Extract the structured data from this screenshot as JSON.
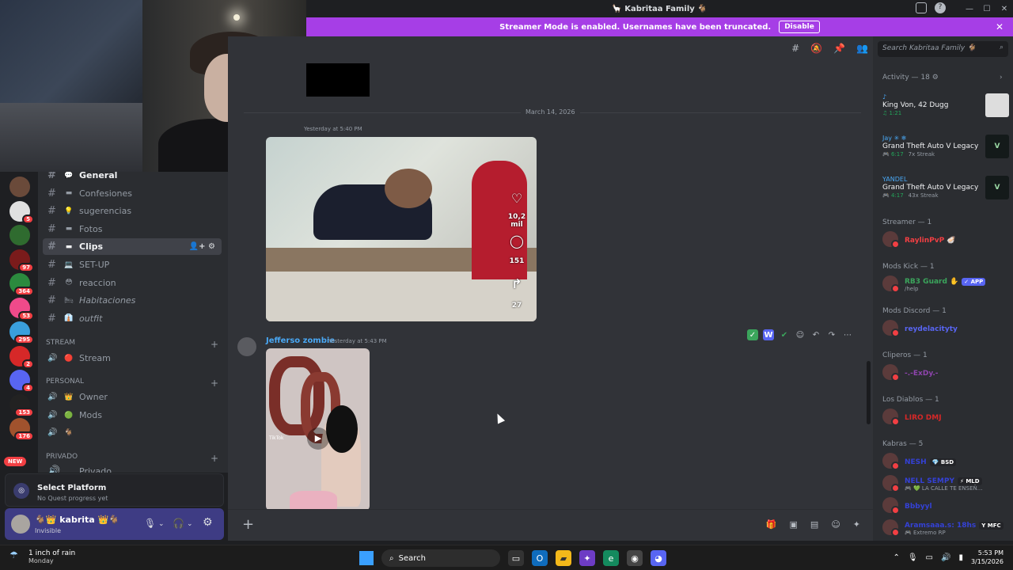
{
  "window": {
    "title": "🦙 Kabritaa Family 🐐",
    "controls": [
      "—",
      "☐",
      "✕"
    ]
  },
  "banner": {
    "text": "Streamer Mode is enabled. Usernames have been truncated.",
    "button": "Disable"
  },
  "servers": [
    {
      "badge": "",
      "color": "#6a4a3a"
    },
    {
      "badge": "5",
      "color": "#e0e0e0"
    },
    {
      "badge": "",
      "color": "#2f6b2f"
    },
    {
      "badge": "97",
      "color": "#7a1b1b"
    },
    {
      "badge": "364",
      "color": "#2b8a3e"
    },
    {
      "badge": "53",
      "color": "#f04a8a"
    },
    {
      "badge": "295",
      "color": "#3a9fdc"
    },
    {
      "badge": "2",
      "color": "#d62828"
    },
    {
      "badge": "4",
      "color": "#5865f2"
    },
    {
      "badge": "153",
      "color": "#222"
    },
    {
      "badge": "176",
      "color": "#a0522d"
    }
  ],
  "server_new_label": "NEW",
  "channels": [
    {
      "label": "General",
      "emoji": "💬",
      "style": "gen"
    },
    {
      "label": "Confesiones",
      "emoji": "▬",
      "style": ""
    },
    {
      "label": "sugerencias",
      "emoji": "💡",
      "style": ""
    },
    {
      "label": "Fotos",
      "emoji": "▬",
      "style": ""
    },
    {
      "label": "Clips",
      "emoji": "▬",
      "style": "active"
    },
    {
      "label": "SET-UP",
      "emoji": "💻",
      "style": ""
    },
    {
      "label": "reaccion",
      "emoji": "😳",
      "style": ""
    },
    {
      "label": "Habitaciones",
      "emoji": "🛏",
      "style": "italic"
    },
    {
      "label": "outfit",
      "emoji": "👔",
      "style": "italic"
    }
  ],
  "categories": {
    "stream": "STREAM",
    "personal": "PERSONAL",
    "privado": "PRIVADO"
  },
  "voice_channels": [
    {
      "label": "Stream",
      "emoji": "🔴"
    },
    {
      "label": "Owner",
      "emoji": "👑"
    },
    {
      "label": "Mods",
      "emoji": "🟢"
    },
    {
      "label": "",
      "emoji": "🐐"
    }
  ],
  "private_partial": "Privado",
  "quest": {
    "title": "Select Platform",
    "subtitle": "No Quest progress yet"
  },
  "user": {
    "name": "🐐👑 kabrita 👑🐐",
    "status": "Invisible"
  },
  "chat": {
    "date_divider": "March 14, 2026",
    "first_time": "Yesterday at 5:40 PM",
    "video1": {
      "likes": "10,2 mil",
      "comments": "151",
      "shares": "27"
    },
    "message": {
      "author": "Jefferso zombie",
      "time": "Yesterday at 5:43 PM"
    },
    "video2_watermark": "TikTok"
  },
  "right": {
    "search_placeholder": "Search Kabritaa Family 🐐",
    "activity_header": "Activity — 18 ⚙",
    "activities": [
      {
        "who": "♪",
        "game": "King Von, 42 Dugg",
        "meta": "♫ 1:21",
        "streak": "",
        "thumb": "album"
      },
      {
        "who": "Jay ✳ ❄",
        "game": "Grand Theft Auto V Legacy",
        "meta": "🎮 6:17",
        "streak": "7x Streak",
        "thumb": "gta"
      },
      {
        "who": "YANDEL",
        "game": "Grand Theft Auto V Legacy",
        "meta": "🎮 4:17",
        "streak": "43x Streak",
        "thumb": "gta"
      }
    ],
    "groups": [
      {
        "label": "Streamer — 1",
        "members": [
          {
            "name": "RaylinPvP 🦪",
            "color": "#f23f43",
            "sub": "",
            "tag": ""
          }
        ]
      },
      {
        "label": "Mods Kick — 1",
        "members": [
          {
            "name": "RB3 Guard ✋",
            "color": "#3ba55c",
            "sub": "/help",
            "tag": "✓ APP"
          }
        ]
      },
      {
        "label": "Mods Discord — 1",
        "members": [
          {
            "name": "reydelacityty",
            "color": "#5865f2",
            "sub": "",
            "tag": ""
          }
        ]
      },
      {
        "label": "Cliperos — 1",
        "members": [
          {
            "name": "-.-ExDy.-",
            "color": "#8e44ad",
            "sub": "",
            "tag": ""
          }
        ]
      },
      {
        "label": "Los Diablos — 1",
        "members": [
          {
            "name": "LIRO DMJ",
            "color": "#d62828",
            "sub": "",
            "tag": ""
          }
        ]
      },
      {
        "label": "Kabras — 5",
        "members": [
          {
            "name": "NESH",
            "color": "#3441d6",
            "sub": "",
            "tag": "💎 BSD"
          },
          {
            "name": "NELL SEMPY",
            "color": "#3441d6",
            "sub": "🎮 💚 LA CALLE TE ENSEÑ...",
            "tag": "⚡ MLD"
          },
          {
            "name": "Bbbyyl",
            "color": "#3441d6",
            "sub": "",
            "tag": ""
          },
          {
            "name": "Aramsaaa.s: 18hs",
            "color": "#3441d6",
            "sub": "🎮 Extremo RP",
            "tag": "Y MFC"
          }
        ]
      }
    ]
  },
  "taskbar": {
    "weather_title": "1 inch of rain",
    "weather_day": "Monday",
    "search_label": "Search",
    "time": "5:53 PM",
    "date": "3/15/2026"
  }
}
